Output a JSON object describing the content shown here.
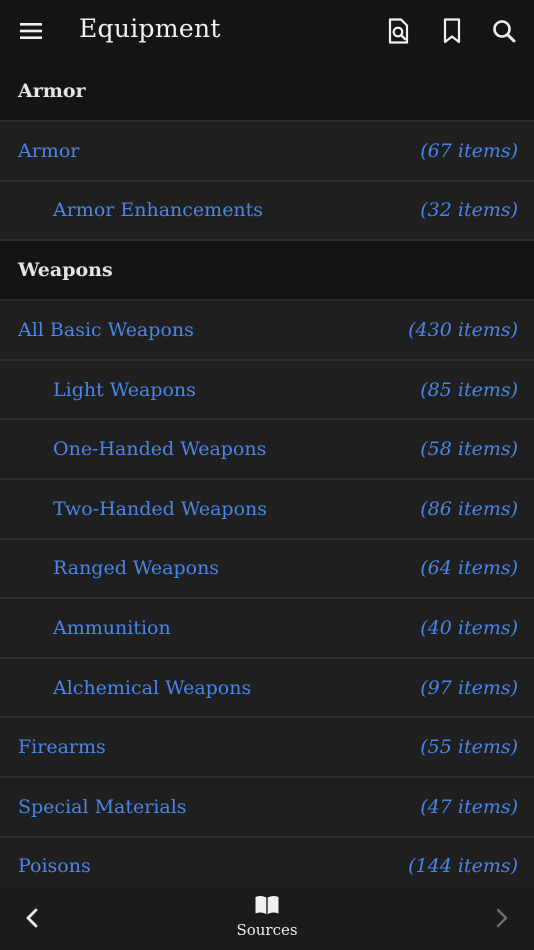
{
  "header": {
    "title": "Equipment",
    "icons": [
      "menu-icon",
      "search-document-icon",
      "bookmark-icon",
      "search-icon"
    ]
  },
  "sections": [
    {
      "title": "Armor",
      "items": [
        {
          "label": "Armor",
          "count": "(67 items)",
          "indent": false
        },
        {
          "label": "Armor Enhancements",
          "count": "(32 items)",
          "indent": true
        }
      ]
    },
    {
      "title": "Weapons",
      "items": [
        {
          "label": "All Basic Weapons",
          "count": "(430 items)",
          "indent": false
        },
        {
          "label": "Light Weapons",
          "count": "(85 items)",
          "indent": true
        },
        {
          "label": "One-Handed Weapons",
          "count": "(58 items)",
          "indent": true
        },
        {
          "label": "Two-Handed Weapons",
          "count": "(86 items)",
          "indent": true
        },
        {
          "label": "Ranged Weapons",
          "count": "(64 items)",
          "indent": true
        },
        {
          "label": "Ammunition",
          "count": "(40 items)",
          "indent": true
        },
        {
          "label": "Alchemical Weapons",
          "count": "(97 items)",
          "indent": true
        },
        {
          "label": "Firearms",
          "count": "(55 items)",
          "indent": false
        },
        {
          "label": "Special Materials",
          "count": "(47 items)",
          "indent": false
        },
        {
          "label": "Poisons",
          "count": "(144 items)",
          "indent": false
        }
      ]
    }
  ],
  "footer": {
    "sources_label": "Sources",
    "icons": [
      "chevron-left-icon",
      "book-icon",
      "chevron-right-icon"
    ]
  },
  "colors": {
    "link": "#4a86ea",
    "background": "#1f1f1f",
    "section_bg": "#141414",
    "header_bg": "#151515"
  }
}
